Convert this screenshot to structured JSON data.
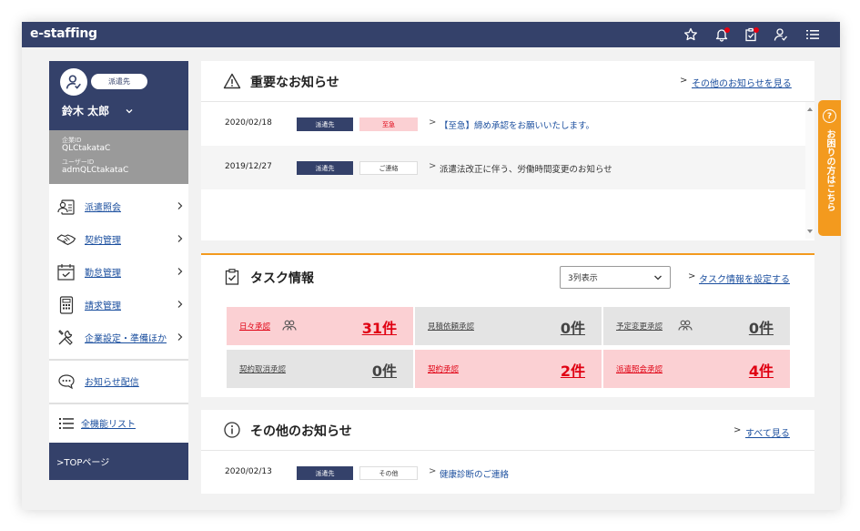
{
  "app": {
    "logo": "e-staffing"
  },
  "topbar": {
    "icons": [
      "star-icon",
      "bell-icon",
      "clipboard-icon",
      "user-icon",
      "menu-list-icon"
    ]
  },
  "user": {
    "role_chip": "派遣先",
    "name": "鈴木 太郎",
    "company_id_label": "企業ID",
    "company_id": "QLCtakataC",
    "user_id_label": "ユーザーID",
    "user_id": "admQLCtakataC"
  },
  "sidebar": {
    "items": [
      {
        "label": "派遣照会",
        "icon": "staff-card-icon"
      },
      {
        "label": "契約管理",
        "icon": "handshake-icon"
      },
      {
        "label": "勤怠管理",
        "icon": "calendar-icon"
      },
      {
        "label": "請求管理",
        "icon": "calculator-icon"
      },
      {
        "label": "企業設定・準備ほか",
        "icon": "tools-icon"
      }
    ],
    "notice_delivery": "お知らせ配信",
    "all_functions": "全機能リスト",
    "top_page": ">TOPページ"
  },
  "important": {
    "title": "重要なお知らせ",
    "more": "その他のお知らせを見る",
    "rows": [
      {
        "date": "2020/02/18",
        "tag1": "派遣先",
        "tag2": "至急",
        "text": "【至急】締め承認をお願いいたします。"
      },
      {
        "date": "2019/12/27",
        "tag1": "派遣先",
        "tag2": "ご連絡",
        "text": "派遣法改正に伴う、労働時間変更のお知らせ"
      }
    ]
  },
  "tasks": {
    "title": "タスク情報",
    "select_value": "3列表示",
    "settings_link": "タスク情報を設定する",
    "tiles": [
      {
        "label": "日々承認",
        "count": "31件",
        "tone": "pink",
        "group_icon": true
      },
      {
        "label": "見積依頼承認",
        "count": "0件",
        "tone": "gray",
        "group_icon": false
      },
      {
        "label": "予定変更承認",
        "count": "0件",
        "tone": "gray",
        "group_icon": true
      },
      {
        "label": "契約取消承認",
        "count": "0件",
        "tone": "gray",
        "group_icon": false
      },
      {
        "label": "契約承認",
        "count": "2件",
        "tone": "pink",
        "group_icon": false
      },
      {
        "label": "派遣照会承認",
        "count": "4件",
        "tone": "pink",
        "group_icon": false
      }
    ]
  },
  "other": {
    "title": "その他のお知らせ",
    "more": "すべて見る",
    "rows": [
      {
        "date": "2020/02/13",
        "tag1": "派遣先",
        "tag2": "その他",
        "text": "健康診断のご連絡"
      }
    ]
  },
  "help_tab": {
    "mark": "?",
    "label": "お困りの方はこちら"
  },
  "colors": {
    "navy": "#34416a",
    "orange": "#f39a1e",
    "pink": "#fbd0d3",
    "red": "#e00012",
    "link": "#1a4e9e"
  }
}
